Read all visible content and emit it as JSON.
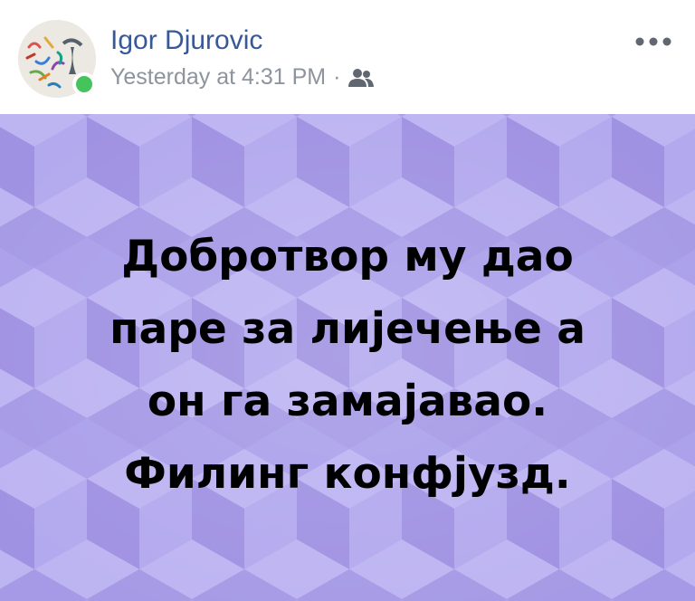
{
  "post": {
    "author": "Igor Djurovic",
    "timestamp": "Yesterday at 4:31 PM",
    "separator": "·",
    "audience_icon": "friends-icon",
    "more_icon": "more-options-icon",
    "online": true,
    "text_lines": [
      "Добротвор му дао",
      "паре за лијечење а",
      "он га замајавао.",
      "Филинг конфјузд."
    ]
  },
  "colors": {
    "author_name": "#385898",
    "meta_text": "#8d949e",
    "online_status": "#44c45b",
    "background_purple": "#a99ee8",
    "post_text": "#000000"
  }
}
